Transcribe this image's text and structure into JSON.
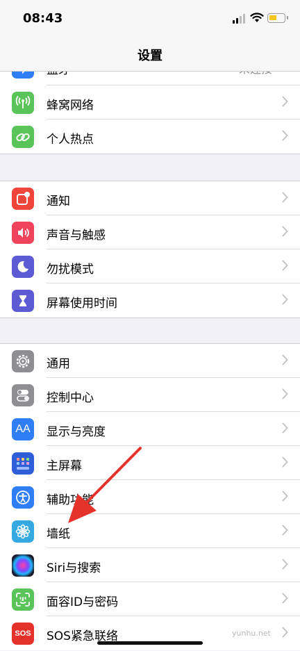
{
  "status_bar": {
    "time": "08:43"
  },
  "nav": {
    "title": "设置"
  },
  "partial_row": {
    "label": "蓝牙",
    "value": "未连接"
  },
  "group1": [
    {
      "label": "蜂窝网络",
      "icon": "cellular-antenna-icon",
      "color": "#5ac35a"
    },
    {
      "label": "个人热点",
      "icon": "hotspot-link-icon",
      "color": "#5ac35a"
    }
  ],
  "group2": [
    {
      "label": "通知",
      "icon": "notification-badge-icon",
      "color": "#f0453a"
    },
    {
      "label": "声音与触感",
      "icon": "speaker-icon",
      "color": "#f0445c"
    },
    {
      "label": "勿扰模式",
      "icon": "moon-icon",
      "color": "#5d5bd4"
    },
    {
      "label": "屏幕使用时间",
      "icon": "hourglass-icon",
      "color": "#5d5bd4"
    }
  ],
  "group3": [
    {
      "label": "通用",
      "icon": "gear-icon",
      "color": "#8e8e93"
    },
    {
      "label": "控制中心",
      "icon": "toggles-icon",
      "color": "#8e8e93"
    },
    {
      "label": "显示与亮度",
      "icon": "text-size-icon",
      "color": "#2f7ef6"
    },
    {
      "label": "主屏幕",
      "icon": "home-grid-icon",
      "color": "#2f5fd8"
    },
    {
      "label": "辅助功能",
      "icon": "accessibility-icon",
      "color": "#2f7ef6"
    },
    {
      "label": "墙纸",
      "icon": "flower-icon",
      "color": "#35a9e0"
    },
    {
      "label": "Siri与搜索",
      "icon": "siri-icon",
      "color": "#1c1c2e"
    },
    {
      "label": "面容ID与密码",
      "icon": "face-id-icon",
      "color": "#5ac35a"
    },
    {
      "label": "SOS紧急联络",
      "icon": "sos-icon",
      "color": "#e5332b"
    }
  ],
  "icon_text": {
    "text_size": "AA",
    "sos": "SOS"
  },
  "watermark": "yunhu.net",
  "arrow_color": "#e5332b"
}
